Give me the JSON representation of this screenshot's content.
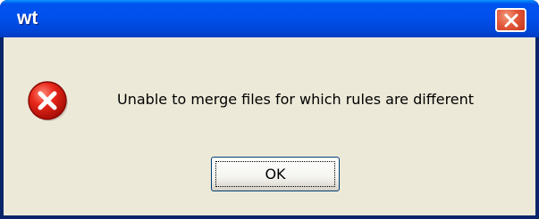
{
  "window": {
    "title": "wt",
    "title_bar_color": "#0050ee",
    "close_icon": "close-icon"
  },
  "dialog": {
    "icon": "error-icon",
    "message": "Unable to merge files for which rules are different",
    "ok_label": "OK",
    "background": "#ece9d8"
  }
}
